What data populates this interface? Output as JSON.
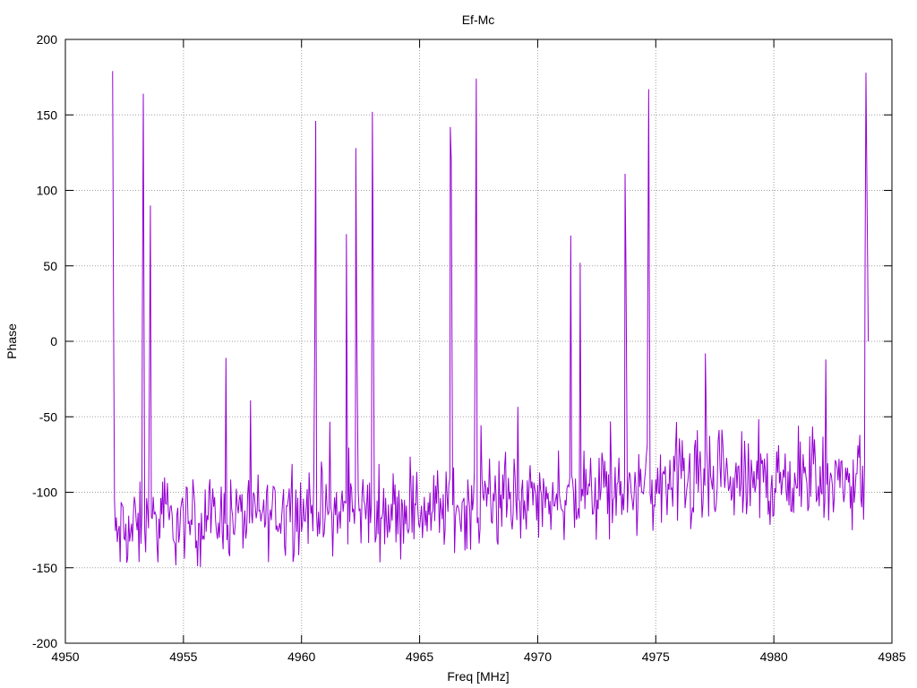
{
  "chart_data": {
    "type": "line",
    "title": "Ef-Mc",
    "xlabel": "Freq [MHz]",
    "ylabel": "Phase",
    "xlim": [
      4950,
      4985
    ],
    "ylim": [
      -200,
      200
    ],
    "xticks": [
      4950,
      4955,
      4960,
      4965,
      4970,
      4975,
      4980,
      4985
    ],
    "yticks": [
      -200,
      -150,
      -100,
      -50,
      0,
      50,
      100,
      150,
      200
    ],
    "grid": true,
    "legend": "none",
    "colors": {
      "series": "#9400d3",
      "grid": "#a0a0a0",
      "axes": "#000000"
    },
    "series": [
      {
        "x_start": 4952.0,
        "x_step": 0.04,
        "spikes": [
          {
            "x": 4952.0,
            "y": 179
          },
          {
            "x": 4952.04,
            "y": 18
          },
          {
            "x": 4953.3,
            "y": 164
          },
          {
            "x": 4953.26,
            "y": 17
          },
          {
            "x": 4953.6,
            "y": 90
          },
          {
            "x": 4953.56,
            "y": -20
          },
          {
            "x": 4956.8,
            "y": -11
          },
          {
            "x": 4960.6,
            "y": 146
          },
          {
            "x": 4960.56,
            "y": 1
          },
          {
            "x": 4961.9,
            "y": 71
          },
          {
            "x": 4962.3,
            "y": 128
          },
          {
            "x": 4962.34,
            "y": 7
          },
          {
            "x": 4963.0,
            "y": 152
          },
          {
            "x": 4963.04,
            "y": 34
          },
          {
            "x": 4966.3,
            "y": 142
          },
          {
            "x": 4966.34,
            "y": 120
          },
          {
            "x": 4967.4,
            "y": 174
          },
          {
            "x": 4967.36,
            "y": 27
          },
          {
            "x": 4971.4,
            "y": 70
          },
          {
            "x": 4971.8,
            "y": 52
          },
          {
            "x": 4973.7,
            "y": 111
          },
          {
            "x": 4973.74,
            "y": 45
          },
          {
            "x": 4974.7,
            "y": 167
          },
          {
            "x": 4974.66,
            "y": 23
          },
          {
            "x": 4977.1,
            "y": -8
          },
          {
            "x": 4982.2,
            "y": -12
          },
          {
            "x": 4983.9,
            "y": 178
          },
          {
            "x": 4983.94,
            "y": 104
          },
          {
            "x": 4983.86,
            "y": 38
          },
          {
            "x": 4984.0,
            "y": 0
          }
        ],
        "baseline_envelope": [
          {
            "x": 4952,
            "mean": -128,
            "amp": 28
          },
          {
            "x": 4955,
            "mean": -120,
            "amp": 25
          },
          {
            "x": 4960,
            "mean": -112,
            "amp": 25
          },
          {
            "x": 4965,
            "mean": -112,
            "amp": 25
          },
          {
            "x": 4970,
            "mean": -105,
            "amp": 25
          },
          {
            "x": 4975,
            "mean": -98,
            "amp": 27
          },
          {
            "x": 4980,
            "mean": -93,
            "amp": 27
          },
          {
            "x": 4984,
            "mean": -92,
            "amp": 28
          }
        ]
      }
    ]
  }
}
